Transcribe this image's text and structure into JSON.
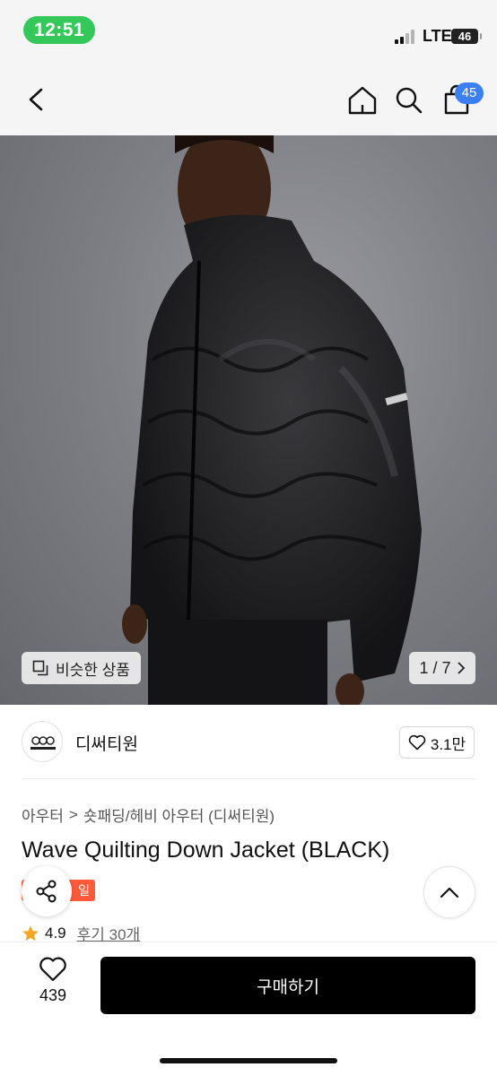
{
  "status_bar": {
    "time": "12:51",
    "network": "LTE",
    "battery": "46"
  },
  "nav": {
    "bag_count": "45"
  },
  "image": {
    "similar_label": "비슷한 상품",
    "page_counter": "1 / 7"
  },
  "brand": {
    "name": "디써티원",
    "logo_text": "DTHIRTYONE",
    "like_count": "3.1만"
  },
  "breadcrumb": {
    "category": "아우터",
    "separator": ">",
    "subcategory": "숏패딩/헤비 아우터 (디써티원)"
  },
  "product": {
    "title": "Wave Quilting Down Jacket (BLACK)",
    "badge": "일",
    "rating": "4.9",
    "review_label": "후기 30개"
  },
  "bottom": {
    "wish_count": "439",
    "buy_label": "구매하기"
  },
  "colors": {
    "accent_blue": "#3b7ff5",
    "status_green": "#34c759",
    "sale_red": "#ff5a3c",
    "star": "#f5a623",
    "buy_button": "#000000"
  },
  "icons": [
    "back-icon",
    "home-icon",
    "search-icon",
    "bag-icon",
    "similar-icon",
    "chevron-right-icon",
    "heart-icon",
    "share-icon",
    "chevron-up-icon",
    "star-icon"
  ]
}
